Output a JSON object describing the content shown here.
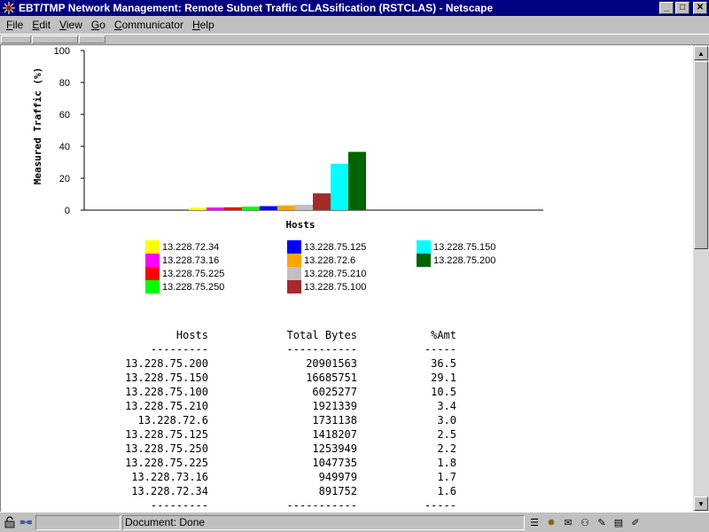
{
  "window": {
    "title": "EBT/TMP Network Management: Remote Subnet Traffic CLASsification (RSTCLAS) - Netscape",
    "minimize_glyph": "_",
    "maximize_glyph": "□",
    "close_glyph": "✕"
  },
  "menu": [
    {
      "key": "F",
      "rest": "ile"
    },
    {
      "key": "E",
      "rest": "dit"
    },
    {
      "key": "V",
      "rest": "iew"
    },
    {
      "key": "G",
      "rest": "o"
    },
    {
      "key": "C",
      "rest": "ommunicator"
    },
    {
      "key": "H",
      "rest": "elp"
    }
  ],
  "status": {
    "text": "Document: Done"
  },
  "chart_data": {
    "type": "bar",
    "xlabel": "Hosts",
    "ylabel": "Measured Traffic (%)",
    "ylim": [
      0,
      100
    ],
    "yticks": [
      "0",
      "20",
      "40",
      "60",
      "80",
      "100"
    ],
    "grid": false,
    "categories": [
      "13.228.72.34",
      "13.228.73.16",
      "13.228.75.225",
      "13.228.75.250",
      "13.228.75.125",
      "13.228.72.6",
      "13.228.75.210",
      "13.228.75.100",
      "13.228.75.150",
      "13.228.75.200"
    ],
    "values": [
      1.6,
      1.7,
      1.8,
      2.2,
      2.5,
      3.0,
      3.4,
      10.5,
      29.1,
      36.5
    ],
    "colors": [
      "#ffff00",
      "#ff00ff",
      "#ff0000",
      "#00ff00",
      "#0000ff",
      "#ffa500",
      "#c0c0c0",
      "#a52a2a",
      "#00ffff",
      "#006400"
    ],
    "legend_placement": "bottom"
  },
  "legend": {
    "columns": [
      [
        {
          "label": "13.228.72.34",
          "color": "#ffff00"
        },
        {
          "label": "13.228.73.16",
          "color": "#ff00ff"
        },
        {
          "label": "13.228.75.225",
          "color": "#ff0000"
        },
        {
          "label": "13.228.75.250",
          "color": "#00ff00"
        }
      ],
      [
        {
          "label": "13.228.75.125",
          "color": "#0000ff"
        },
        {
          "label": "13.228.72.6",
          "color": "#ffa500"
        },
        {
          "label": "13.228.75.210",
          "color": "#c0c0c0"
        },
        {
          "label": "13.228.75.100",
          "color": "#a52a2a"
        }
      ],
      [
        {
          "label": "13.228.75.150",
          "color": "#00ffff"
        },
        {
          "label": "13.228.75.200",
          "color": "#006400"
        }
      ]
    ]
  },
  "table": {
    "headers": [
      "Hosts",
      "Total Bytes",
      "%Amt"
    ],
    "rules": [
      "---------",
      "-----------",
      "-----"
    ],
    "rows": [
      [
        "13.228.75.200",
        "20901563",
        "36.5"
      ],
      [
        "13.228.75.150",
        "16685751",
        "29.1"
      ],
      [
        "13.228.75.100",
        "6025277",
        "10.5"
      ],
      [
        "13.228.75.210",
        "1921339",
        "3.4"
      ],
      [
        "13.228.72.6",
        "1731138",
        "3.0"
      ],
      [
        "13.228.75.125",
        "1418207",
        "2.5"
      ],
      [
        "13.228.75.250",
        "1253949",
        "2.2"
      ],
      [
        "13.228.75.225",
        "1047735",
        "1.8"
      ],
      [
        "13.228.73.16",
        "949979",
        "1.7"
      ],
      [
        "13.228.72.34",
        "891752",
        "1.6"
      ]
    ],
    "footer_rules": [
      "---------",
      "-----------",
      "-----"
    ]
  }
}
